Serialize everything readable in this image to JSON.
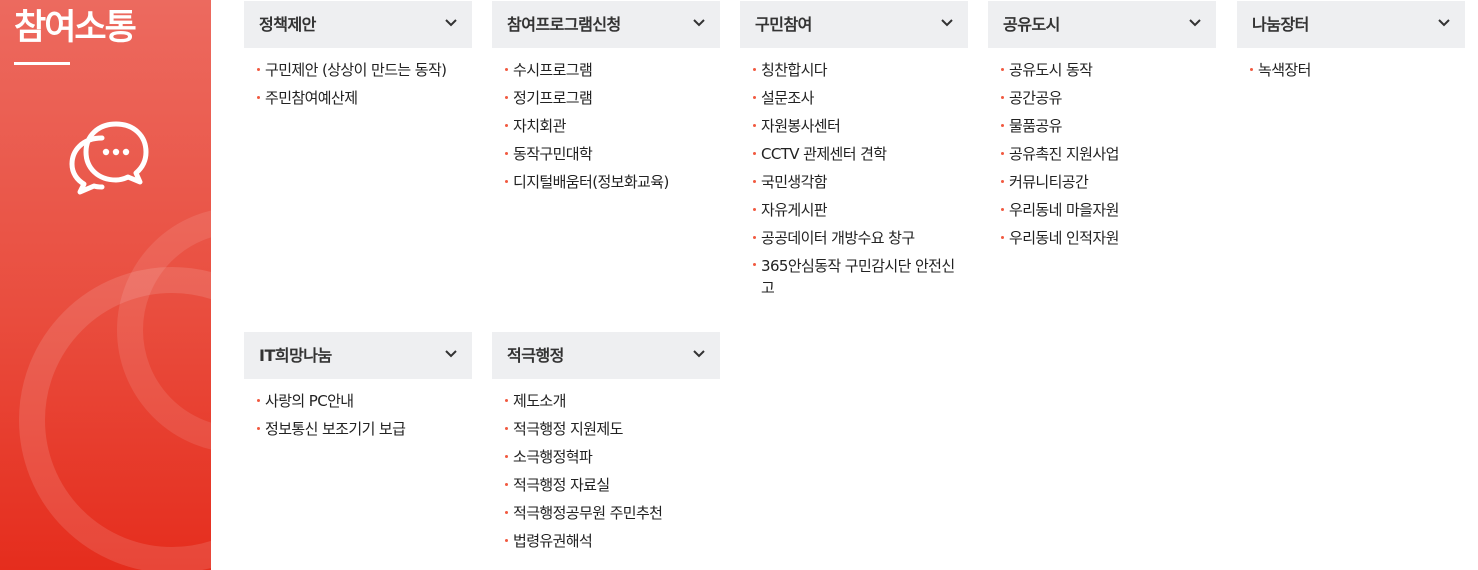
{
  "sidebar": {
    "title": "참여소통",
    "icon": "chat-bubbles-icon"
  },
  "menus": [
    {
      "title": "정책제안",
      "items": [
        "구민제안 (상상이 만드는 동작)",
        "주민참여예산제"
      ]
    },
    {
      "title": "참여프로그램신청",
      "items": [
        "수시프로그램",
        "정기프로그램",
        "자치회관",
        "동작구민대학",
        "디지털배움터(정보화교육)"
      ]
    },
    {
      "title": "구민참여",
      "items": [
        "칭찬합시다",
        "설문조사",
        "자원봉사센터",
        "CCTV 관제센터 견학",
        "국민생각함",
        "자유게시판",
        "공공데이터 개방수요 창구",
        "365안심동작 구민감시단 안전신고"
      ]
    },
    {
      "title": "공유도시",
      "items": [
        "공유도시 동작",
        "공간공유",
        "물품공유",
        "공유촉진 지원사업",
        "커뮤니티공간",
        "우리동네 마을자원",
        "우리동네 인적자원"
      ]
    },
    {
      "title": "나눔장터",
      "items": [
        "녹색장터"
      ]
    },
    {
      "title": "IT희망나눔",
      "items": [
        "사랑의 PC안내",
        "정보통신 보조기기 보급"
      ]
    },
    {
      "title": "적극행정",
      "items": [
        "제도소개",
        "적극행정 지원제도",
        "소극행정혁파",
        "적극행정 자료실",
        "적극행정공무원 주민추천",
        "법령유권해석"
      ]
    }
  ],
  "colors": {
    "accent": "#e94d3e",
    "bullet": "#f15a40",
    "panel_bg": "#eeeff1"
  }
}
